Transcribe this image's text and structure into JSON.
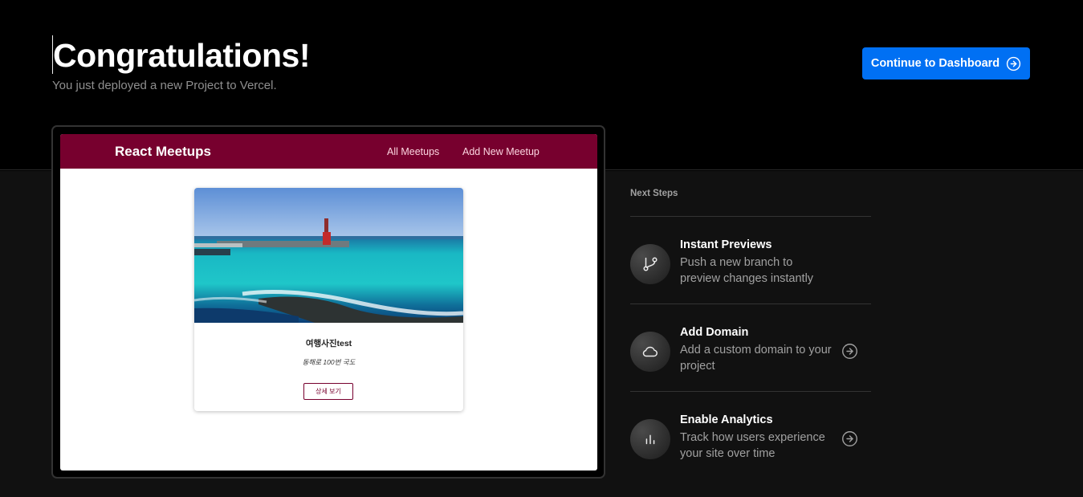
{
  "header": {
    "title": "Congratulations!",
    "subtitle": "You just deployed a new Project to Vercel.",
    "dashboard_button": "Continue to Dashboard"
  },
  "preview": {
    "app_name": "React Meetups",
    "nav": [
      "All Meetups",
      "Add New Meetup"
    ],
    "meetup": {
      "title": "여행사진test",
      "address": "동해로 100번 국도",
      "button": "상세 보기"
    }
  },
  "next_steps": {
    "title": "Next Steps",
    "items": [
      {
        "title": "Instant Previews",
        "description": "Push a new branch to preview changes instantly",
        "icon": "git-branch-icon"
      },
      {
        "title": "Add Domain",
        "description": "Add a custom domain to your project",
        "icon": "cloud-icon"
      },
      {
        "title": "Enable Analytics",
        "description": "Track how users experience your site over time",
        "icon": "bar-chart-icon"
      }
    ]
  },
  "colors": {
    "accent": "#0070f3",
    "app_header": "#77002e",
    "background_top": "#000000",
    "background_bottom": "#111111"
  }
}
